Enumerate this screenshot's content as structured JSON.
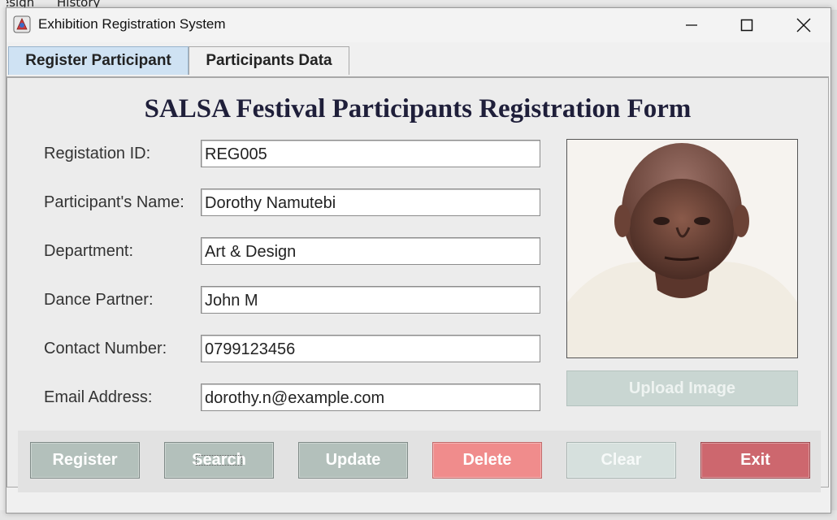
{
  "background": {
    "menu_items": [
      "esign",
      "History"
    ]
  },
  "window": {
    "title": "Exhibition Registration System",
    "controls": [
      "minimize",
      "maximize",
      "close"
    ]
  },
  "tabs": [
    {
      "label": "Register Participant",
      "active": true
    },
    {
      "label": "Participants Data",
      "active": false
    }
  ],
  "form": {
    "title": "SALSA Festival Participants Registration Form",
    "fields": [
      {
        "label": "Registation ID:",
        "value": "REG005"
      },
      {
        "label": "Participant's Name:",
        "value": "Dorothy Namutebi"
      },
      {
        "label": "Department:",
        "value": "Art & Design"
      },
      {
        "label": "Dance Partner:",
        "value": "John M"
      },
      {
        "label": "Contact Number:",
        "value": "0799123456"
      },
      {
        "label": "Email Address:",
        "value": "dorothy.n@example.com"
      }
    ],
    "photo_alt": "participant-photo",
    "upload_label": "Upload Image"
  },
  "actions": {
    "register": "Register",
    "search": "Search",
    "update": "Update",
    "delete": "Delete",
    "clear": "Clear",
    "exit": "Exit"
  },
  "colors": {
    "tab_active": "#cfe2f3",
    "button_gray": "#b3c0bb",
    "button_delete": "#f08c8c",
    "button_clear": "#d6e0dd",
    "button_exit": "#cd676e",
    "title_text": "#1f1f3a"
  }
}
